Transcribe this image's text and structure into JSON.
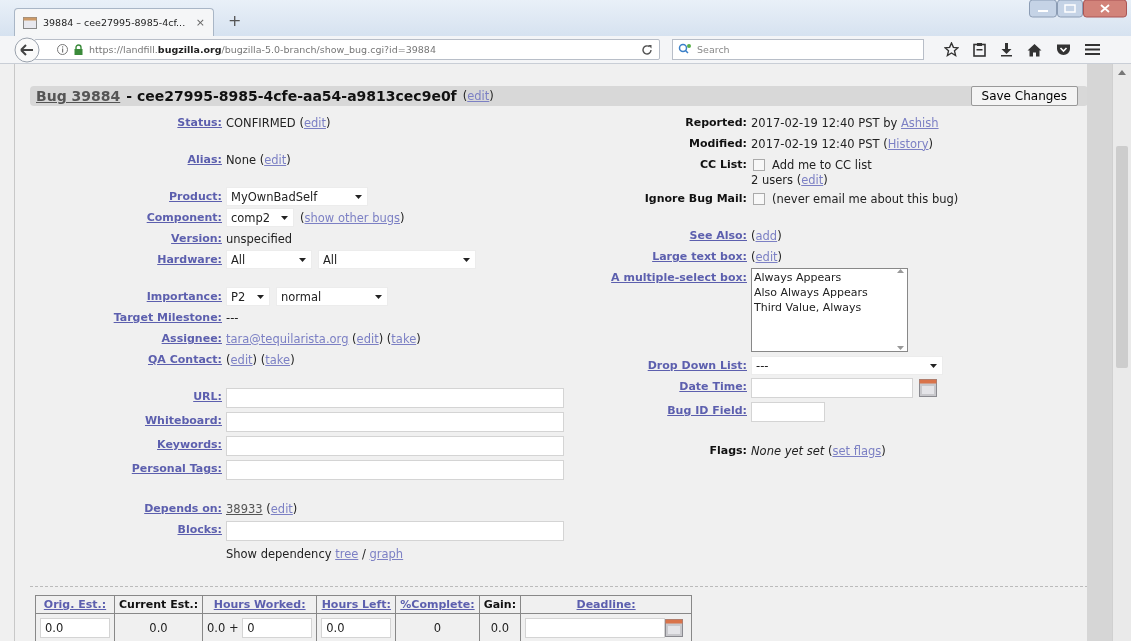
{
  "browser": {
    "tab": {
      "title": "39884 – cee27995-8985-4cf...",
      "close": "×"
    },
    "new_tab": "+",
    "url": "https://landfill.**bugzilla.org**/bugzilla-5.0-branch/show_bug.cgi?id=39884",
    "search": {
      "placeholder": "Search"
    }
  },
  "header": {
    "bug_link": "Bug 39884",
    "title": "- cee27995-8985-4cfe-aa54-a9813cec9e0f",
    "open_paren": "(",
    "edit": "edit",
    "close_paren": ")",
    "save_button": "Save Changes"
  },
  "left_groups": [
    [
      {
        "label": "Status:",
        "kind": "link",
        "lines": [
          [
            {
              "kind": "text",
              "text": "CONFIRMED ("
            },
            {
              "kind": "link",
              "text": "edit"
            },
            {
              "kind": "text",
              "text": ")"
            }
          ]
        ]
      }
    ],
    [
      {
        "label": "Alias:",
        "kind": "link",
        "lines": [
          [
            {
              "kind": "text",
              "text": "None ("
            },
            {
              "kind": "link",
              "text": "edit"
            },
            {
              "kind": "text",
              "text": ")"
            }
          ]
        ]
      }
    ],
    [
      {
        "label": "Product:",
        "kind": "link",
        "lines": [
          [
            {
              "kind": "select",
              "value": "MyOwnBadSelf"
            }
          ]
        ]
      },
      {
        "label": "Component:",
        "kind": "link",
        "lines": [
          [
            {
              "kind": "select",
              "value": "comp2"
            },
            {
              "kind": "text",
              "text": "("
            },
            {
              "kind": "link",
              "text": "show other bugs"
            },
            {
              "kind": "text",
              "text": ")"
            }
          ]
        ]
      },
      {
        "label": "Version:",
        "kind": "link",
        "lines": [
          [
            {
              "kind": "text",
              "text": "unspecified"
            }
          ]
        ]
      },
      {
        "label": "Hardware:",
        "kind": "link",
        "lines": [
          [
            {
              "kind": "select",
              "value": "All"
            },
            {
              "kind": "select",
              "value": "All"
            }
          ]
        ]
      }
    ],
    [
      {
        "label": "Importance:",
        "kind": "link",
        "lines": [
          [
            {
              "kind": "select",
              "value": "P2"
            },
            {
              "kind": "select",
              "value": "normal"
            }
          ]
        ]
      },
      {
        "label": "Target Milestone:",
        "kind": "link",
        "lines": [
          [
            {
              "kind": "text",
              "text": "---"
            }
          ]
        ]
      },
      {
        "label": "Assignee:",
        "kind": "link",
        "lines": [
          [
            {
              "kind": "link",
              "text": "tara@tequilarista.org"
            },
            {
              "kind": "text",
              "text": " ("
            },
            {
              "kind": "link",
              "text": "edit"
            },
            {
              "kind": "text",
              "text": ") ("
            },
            {
              "kind": "link",
              "text": "take"
            },
            {
              "kind": "text",
              "text": ")"
            }
          ]
        ]
      },
      {
        "label": "QA Contact:",
        "kind": "link",
        "lines": [
          [
            {
              "kind": "text",
              "text": "("
            },
            {
              "kind": "link",
              "text": "edit"
            },
            {
              "kind": "text",
              "text": ") ("
            },
            {
              "kind": "link",
              "text": "take"
            },
            {
              "kind": "text",
              "text": ")"
            }
          ]
        ]
      }
    ],
    [
      {
        "label": "URL:",
        "kind": "link",
        "lines": [
          [
            {
              "kind": "input"
            }
          ]
        ]
      },
      {
        "label": "Whiteboard:",
        "kind": "link",
        "lines": [
          [
            {
              "kind": "input"
            }
          ]
        ]
      },
      {
        "label": "Keywords:",
        "kind": "link",
        "lines": [
          [
            {
              "kind": "input"
            }
          ]
        ]
      },
      {
        "label": "Personal Tags:",
        "kind": "link",
        "lines": [
          [
            {
              "kind": "input"
            }
          ]
        ]
      }
    ],
    [
      {
        "label": "Depends on:",
        "kind": "link",
        "lines": [
          [
            {
              "kind": "visited",
              "text": "38933"
            },
            {
              "kind": "text",
              "text": " ("
            },
            {
              "kind": "link",
              "text": "edit"
            },
            {
              "kind": "text",
              "text": ")"
            }
          ]
        ]
      },
      {
        "label": "Blocks:",
        "kind": "link",
        "lines": [
          [
            {
              "kind": "input"
            }
          ]
        ]
      },
      {
        "lines": [
          [
            {
              "kind": "text",
              "text": "Show dependency "
            },
            {
              "kind": "link",
              "text": "tree"
            },
            {
              "kind": "text",
              "text": " / "
            },
            {
              "kind": "link",
              "text": "graph"
            }
          ]
        ]
      }
    ]
  ],
  "right_groups": [
    [
      {
        "label": "Reported:",
        "kind": "plain",
        "lines": [
          [
            {
              "kind": "text",
              "text": "2017-02-19 12:40 PST by "
            },
            {
              "kind": "link",
              "text": "Ashish"
            }
          ]
        ]
      },
      {
        "label": "Modified:",
        "kind": "plain",
        "lines": [
          [
            {
              "kind": "text",
              "text": "2017-02-19 12:40 PST ("
            },
            {
              "kind": "link",
              "text": "History"
            },
            {
              "kind": "text",
              "text": ")"
            }
          ]
        ]
      },
      {
        "label": "CC List:",
        "kind": "plain",
        "lines": [
          [
            {
              "kind": "checkbox",
              "checked": false
            },
            {
              "kind": "text",
              "text": "Add me to CC list"
            }
          ],
          [
            {
              "kind": "text",
              "text": "2 users ("
            },
            {
              "kind": "link",
              "text": "edit"
            },
            {
              "kind": "text",
              "text": ")"
            }
          ]
        ]
      },
      {
        "label": "Ignore Bug Mail:",
        "kind": "plain",
        "lines": [
          [
            {
              "kind": "checkbox",
              "checked": false
            },
            {
              "kind": "text",
              "text": "(never email me about this bug)"
            }
          ]
        ]
      }
    ],
    [
      {
        "label": "See Also:",
        "kind": "link",
        "lines": [
          [
            {
              "kind": "text",
              "text": "("
            },
            {
              "kind": "link",
              "text": "add"
            },
            {
              "kind": "text",
              "text": ")"
            }
          ]
        ]
      },
      {
        "label": "Large text box:",
        "kind": "link",
        "lines": [
          [
            {
              "kind": "text",
              "text": "("
            },
            {
              "kind": "link",
              "text": "edit"
            },
            {
              "kind": "text",
              "text": ")"
            }
          ]
        ]
      },
      {
        "label": "A multiple-select box:",
        "kind": "link",
        "lines": [
          [
            {
              "kind": "listbox",
              "options": [
                {
                  "text": "Always Appears",
                  "selected": false
                },
                {
                  "text": "Also Always Appears",
                  "selected": false
                },
                {
                  "text": "Third Value, Always",
                  "selected": false
                }
              ]
            }
          ]
        ]
      },
      {
        "label": "Drop Down List:",
        "kind": "link",
        "lines": [
          [
            {
              "kind": "select",
              "value": "---"
            }
          ]
        ]
      },
      {
        "label": "Date Time:",
        "kind": "link",
        "lines": [
          [
            {
              "kind": "input"
            },
            {
              "kind": "calendar"
            }
          ]
        ]
      },
      {
        "label": "Bug ID Field:",
        "kind": "link",
        "lines": [
          [
            {
              "kind": "input"
            }
          ]
        ]
      }
    ],
    [
      {
        "label": "Flags:",
        "kind": "plain",
        "lines": [
          [
            {
              "kind": "italic",
              "text": "None yet set"
            },
            {
              "kind": "text",
              "text": " ("
            },
            {
              "kind": "link",
              "text": "set flags"
            },
            {
              "kind": "text",
              "text": ")"
            }
          ]
        ]
      }
    ]
  ],
  "time_tracking": {
    "columns": [
      {
        "label": "Orig. Est.:",
        "kind": "link"
      },
      {
        "label": "Current Est.:",
        "kind": "plain"
      },
      {
        "label": "Hours Worked:",
        "kind": "link"
      },
      {
        "label": "Hours Left:",
        "kind": "link"
      },
      {
        "label": "%Complete:",
        "kind": "link"
      },
      {
        "label": "Gain:",
        "kind": "plain"
      },
      {
        "label": "Deadline:",
        "kind": "link"
      }
    ],
    "cells": [
      [
        {
          "kind": "input",
          "value": "0.0"
        }
      ],
      [
        {
          "kind": "text",
          "text": "0.0"
        }
      ],
      [
        {
          "kind": "text",
          "text": "0.0 + "
        },
        {
          "kind": "input",
          "value": "0"
        }
      ],
      [
        {
          "kind": "input",
          "value": "0.0"
        }
      ],
      [
        {
          "kind": "text",
          "text": "0"
        }
      ],
      [
        {
          "kind": "text",
          "text": "0.0"
        }
      ],
      [
        {
          "kind": "input"
        },
        {
          "kind": "calendar"
        }
      ]
    ]
  }
}
